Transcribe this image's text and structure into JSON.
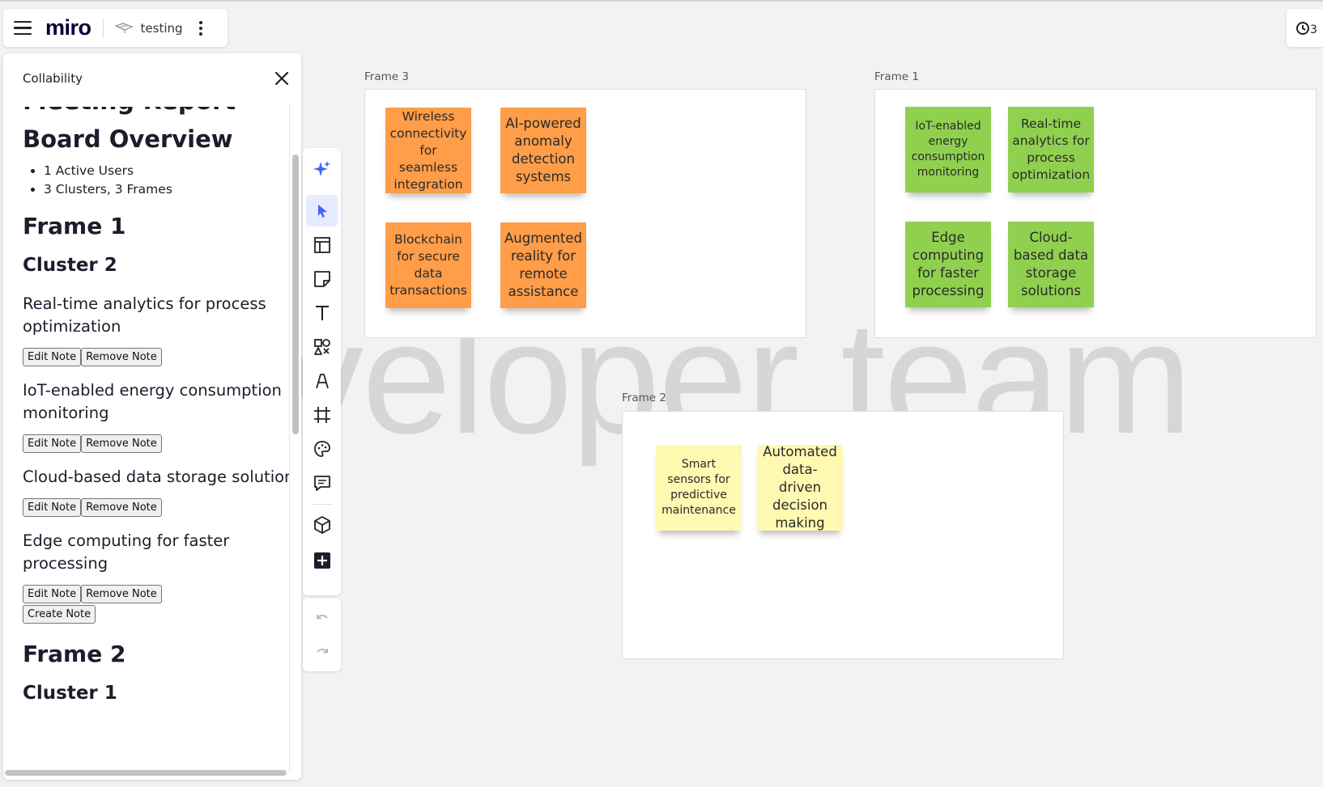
{
  "header": {
    "logo": "miro",
    "board_name": "testing"
  },
  "watermark": "veloper team",
  "panel": {
    "title": "Collability",
    "cut_heading": "Meeting Report",
    "overview_heading": "Board Overview",
    "stats": [
      "1 Active Users",
      "3 Clusters, 3 Frames"
    ],
    "frame1_heading": "Frame 1",
    "cluster2_heading": "Cluster 2",
    "notes": [
      "Real-time analytics for process optimization",
      "IoT-enabled energy consumption monitoring",
      "Cloud-based data storage solutions",
      "Edge computing for faster processing"
    ],
    "edit_label": "Edit Note",
    "remove_label": "Remove Note",
    "create_label": "Create Note",
    "frame2_heading": "Frame 2",
    "cluster1_heading": "Cluster 1"
  },
  "toolbar": {
    "tools": [
      "ai-sparkle",
      "select",
      "templates",
      "sticky-note",
      "text",
      "shapes",
      "pen",
      "frame",
      "stickers",
      "comment",
      "apps",
      "add-more"
    ],
    "active_tool": "select",
    "accent_color": "#4262ff"
  },
  "frames": [
    {
      "label": "Frame 3",
      "color": "#ff9d48",
      "notes": [
        "Wireless connectivity for seamless integration",
        "AI-powered anomaly detection systems",
        "Blockchain for secure data transactions",
        "Augmented reality for remote assistance"
      ]
    },
    {
      "label": "Frame 1",
      "color": "#8fd14f",
      "notes": [
        "IoT-enabled energy consumption monitoring",
        "Real-time analytics for process optimization",
        "Edge computing for faster processing",
        "Cloud-based data storage solutions"
      ]
    },
    {
      "label": "Frame 2",
      "color": "#fff9b1",
      "notes": [
        "Smart sensors for predictive maintenance",
        "Automated data-driven decision making"
      ]
    }
  ]
}
